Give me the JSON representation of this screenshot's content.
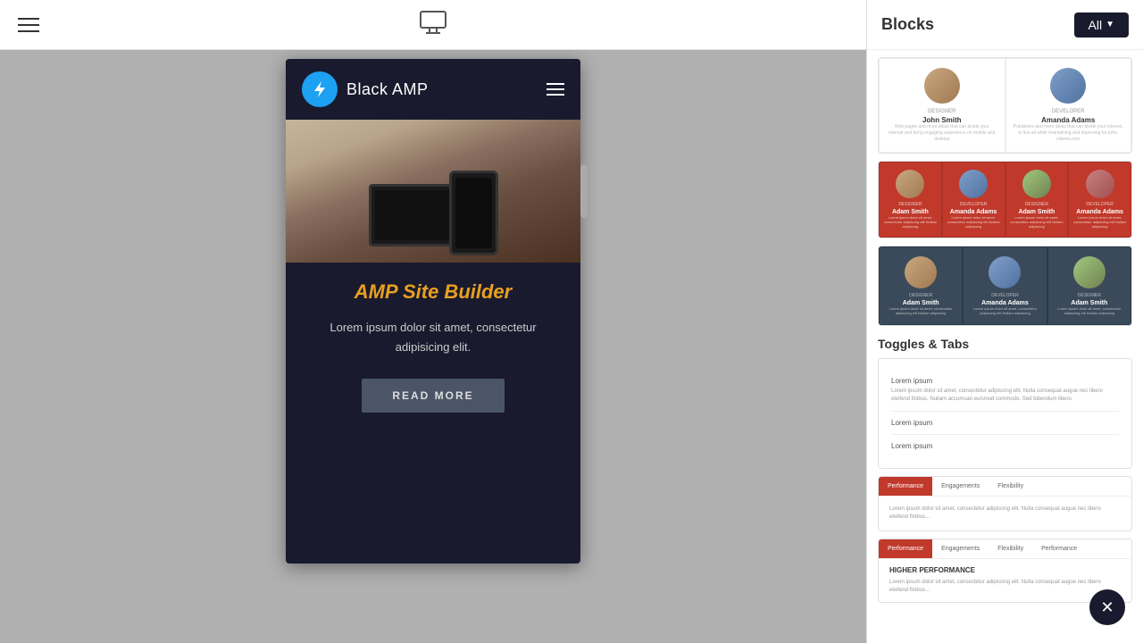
{
  "toolbar": {
    "monitor_icon": "monitor",
    "menu_icon": "hamburger"
  },
  "mobile_preview": {
    "nav": {
      "brand_name": "Black AMP",
      "icon": "lightning"
    },
    "hero": {
      "alt": "Devices on table"
    },
    "content": {
      "headline": "AMP Site Builder",
      "body": "Lorem ipsum dolor sit amet, consectetur adipisicing elit.",
      "cta": "READ MORE"
    }
  },
  "right_panel": {
    "title": "Blocks",
    "all_button": "All",
    "sections": [
      {
        "id": "team-2col",
        "type": "team-2col",
        "members": [
          {
            "name": "John Smith",
            "role": "Designer",
            "desc": "Web pages and more ideas that can divide your interest..."
          },
          {
            "name": "Amanda Adams",
            "role": "Developer",
            "desc": "Publishers and more ideas that can divide your interest..."
          }
        ]
      },
      {
        "id": "team-4col-red",
        "type": "team-4col",
        "members": [
          {
            "name": "Adam Smith",
            "role": "Designer",
            "desc": "Lorem ipsum dolor sit amet, consectetur adipiscing elit Nullam adipiscing"
          },
          {
            "name": "Amanda Adams",
            "role": "Developer",
            "desc": "Lorem ipsum dolor sit amet, consectetur adipiscing elit Nullam adipiscing"
          },
          {
            "name": "Adam Smith",
            "role": "Designer",
            "desc": "Lorem ipsum dolor sit amet, consectetur adipiscing elit Nullam adipiscing"
          },
          {
            "name": "Amanda Adams",
            "role": "Developer",
            "desc": "Lorem ipsum dolor sit amet, consectetur adipiscing elit Nullam adipiscing"
          }
        ]
      },
      {
        "id": "team-3col-dark",
        "type": "team-3col",
        "members": [
          {
            "name": "Adam Smith",
            "role": "Designer",
            "desc": "Lorem ipsum dolor sit amet, consectetur adipiscing elit Nullam adipiscing"
          },
          {
            "name": "Amanda Adams",
            "role": "Developer",
            "desc": "Lorem ipsum dolor sit amet, consectetur adipiscing elit Nullam adipiscing"
          },
          {
            "name": "Adam Smith",
            "role": "Designer",
            "desc": "Lorem ipsum dolor sit amet, consectetur adipiscing elit Nullam adipiscing"
          }
        ]
      }
    ],
    "toggles_section": {
      "label": "Toggles & Tabs",
      "blocks": [
        {
          "id": "toggle-plain",
          "items": [
            {
              "label": "Lorem ipsum",
              "content": "Lorem ipsum dolor sit amet, consectetur adipiscing elit. Nulla consequat augue nec libero eleifend finibus. Nullam accumsan euismod commodo."
            },
            {
              "label": "Lorem ipsum",
              "content": ""
            },
            {
              "label": "Lorem ipsum",
              "content": ""
            }
          ]
        },
        {
          "id": "toggle-tabs",
          "tabs": [
            "Performance",
            "Engagements",
            "Flexibility"
          ],
          "active_tab": 0,
          "content": "Lorem ipsum dolor sit amet, consectetur adipiscing elit..."
        },
        {
          "id": "toggle-tabs-red",
          "tabs": [
            "Performance",
            "Engagements",
            "Flexibility",
            "Performance"
          ],
          "active_tab": 0,
          "headline": "HIGHER PERFORMANCE",
          "content": "Lorem ipsum dolor sit amet..."
        }
      ]
    }
  }
}
